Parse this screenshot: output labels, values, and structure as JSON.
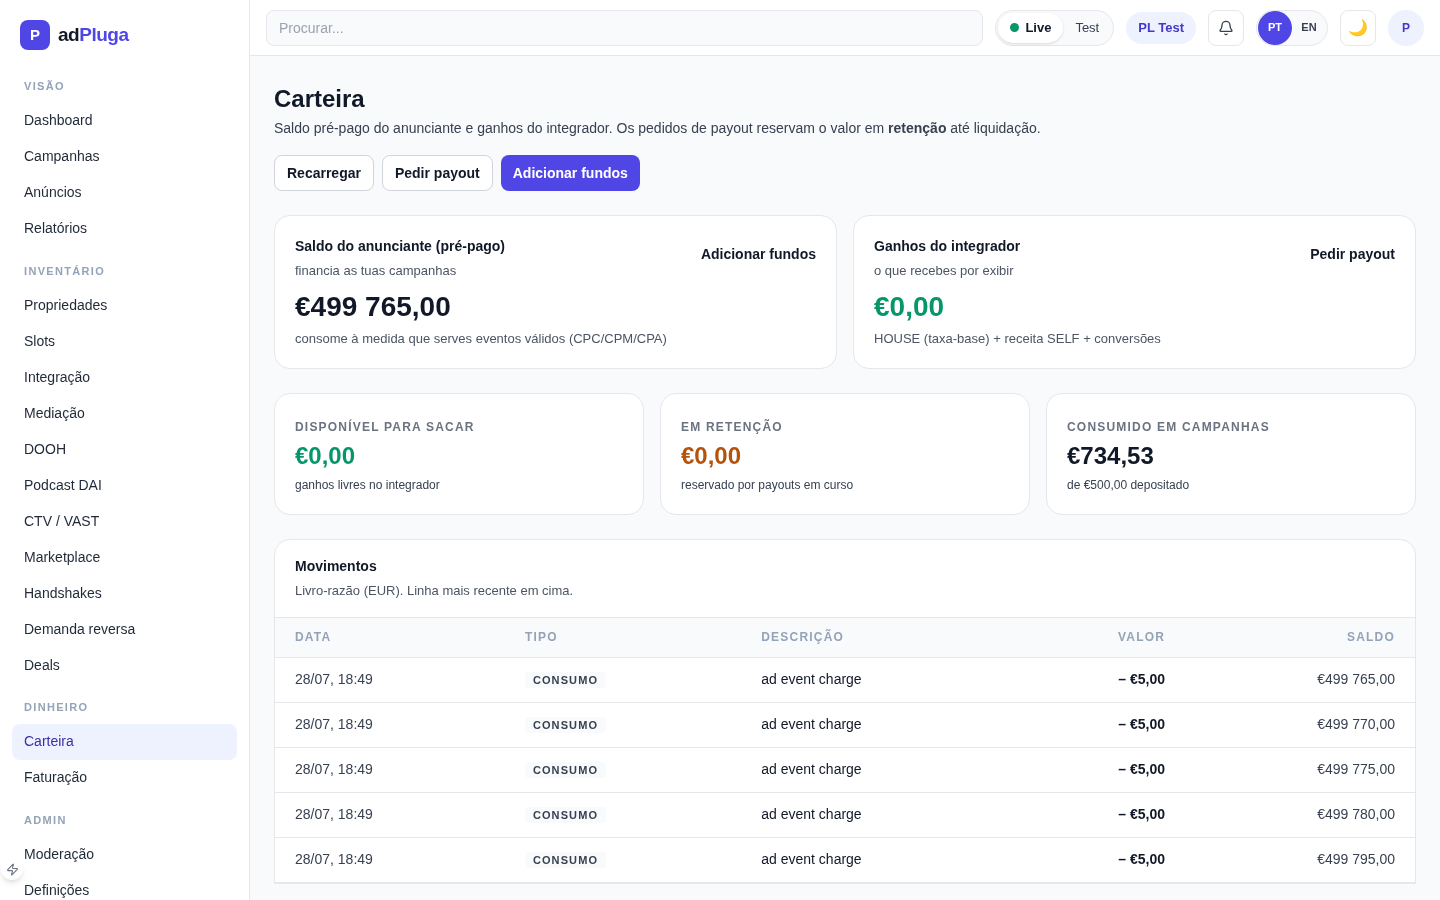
{
  "brand": {
    "logo_letter": "P",
    "prefix": "ad",
    "name": "Pluga"
  },
  "sidebar": {
    "sections": [
      {
        "title": "VISÃO",
        "items": [
          {
            "label": "Dashboard",
            "selected": false
          },
          {
            "label": "Campanhas",
            "selected": false
          },
          {
            "label": "Anúncios",
            "selected": false
          },
          {
            "label": "Relatórios",
            "selected": false
          }
        ]
      },
      {
        "title": "INVENTÁRIO",
        "items": [
          {
            "label": "Propriedades",
            "selected": false
          },
          {
            "label": "Slots",
            "selected": false
          },
          {
            "label": "Integração",
            "selected": false
          },
          {
            "label": "Mediação",
            "selected": false
          },
          {
            "label": "DOOH",
            "selected": false
          },
          {
            "label": "Podcast DAI",
            "selected": false
          },
          {
            "label": "CTV / VAST",
            "selected": false
          },
          {
            "label": "Marketplace",
            "selected": false
          },
          {
            "label": "Handshakes",
            "selected": false
          },
          {
            "label": "Demanda reversa",
            "selected": false
          },
          {
            "label": "Deals",
            "selected": false
          }
        ]
      },
      {
        "title": "DINHEIRO",
        "items": [
          {
            "label": "Carteira",
            "selected": true
          },
          {
            "label": "Faturação",
            "selected": false
          }
        ]
      },
      {
        "title": "ADMIN",
        "items": [
          {
            "label": "Moderação",
            "selected": false
          },
          {
            "label": "Definições",
            "selected": false
          }
        ]
      }
    ]
  },
  "topbar": {
    "search": {
      "placeholder": "Procurar..."
    },
    "mode": [
      {
        "label": "Live",
        "selected": true
      },
      {
        "label": "Test",
        "selected": false
      }
    ],
    "tenant": "PL Test",
    "languages": [
      {
        "label": "PT",
        "selected": true
      },
      {
        "label": "EN",
        "selected": false
      }
    ],
    "theme_icon": "🌙",
    "avatar": "P"
  },
  "page": {
    "title": "Carteira",
    "subtitle": "Saldo pré-pago do anunciante e ganhos do integrador. Os pedidos de payout reservam o valor em **retenção** até liquidação.",
    "actions": [
      {
        "label": "Recarregar",
        "kind": "secondary"
      },
      {
        "label": "Pedir payout",
        "kind": "secondary"
      },
      {
        "label": "Adicionar fundos",
        "kind": "primary"
      }
    ]
  },
  "balance_cards": [
    {
      "title": "Saldo do anunciante (pré-pago)",
      "subtitle": "financia as tuas campanhas",
      "amount": "€499 765,00",
      "color": "#111827",
      "note": "consome à medida que serves eventos válidos (CPC/CPM/CPA)",
      "action": "Adicionar fundos"
    },
    {
      "title": "Ganhos do integrador",
      "subtitle": "o que recebes por exibir",
      "amount": "€0,00",
      "color": "#059669",
      "note": "HOUSE (taxa-base) + receita SELF + conversões",
      "action": "Pedir payout"
    }
  ],
  "stat_cards": [
    {
      "label": "DISPONÍVEL PARA SACAR",
      "amount": "€0,00",
      "color": "#059669",
      "note": "ganhos livres no integrador"
    },
    {
      "label": "EM RETENÇÃO",
      "amount": "€0,00",
      "color": "#b45309",
      "note": "reservado por payouts em curso"
    },
    {
      "label": "CONSUMIDO EM CAMPANHAS",
      "amount": "€734,53",
      "color": "#111827",
      "note": "de €500,00 depositado"
    }
  ],
  "movements": {
    "title": "Movimentos",
    "subtitle": "Livro-razão (EUR). Linha mais recente em cima.",
    "columns": [
      "DATA",
      "TIPO",
      "DESCRIÇÃO",
      "VALOR",
      "SALDO"
    ],
    "rows": [
      {
        "date": "28/07, 18:49",
        "type": "CONSUMO",
        "description": "ad event charge",
        "amount": "– €5,00",
        "balance": "€499 765,00"
      },
      {
        "date": "28/07, 18:49",
        "type": "CONSUMO",
        "description": "ad event charge",
        "amount": "– €5,00",
        "balance": "€499 770,00"
      },
      {
        "date": "28/07, 18:49",
        "type": "CONSUMO",
        "description": "ad event charge",
        "amount": "– €5,00",
        "balance": "€499 775,00"
      },
      {
        "date": "28/07, 18:49",
        "type": "CONSUMO",
        "description": "ad event charge",
        "amount": "– €5,00",
        "balance": "€499 780,00"
      },
      {
        "date": "28/07, 18:49",
        "type": "CONSUMO",
        "description": "ad event charge",
        "amount": "– €5,00",
        "balance": "€499 795,00"
      }
    ]
  }
}
